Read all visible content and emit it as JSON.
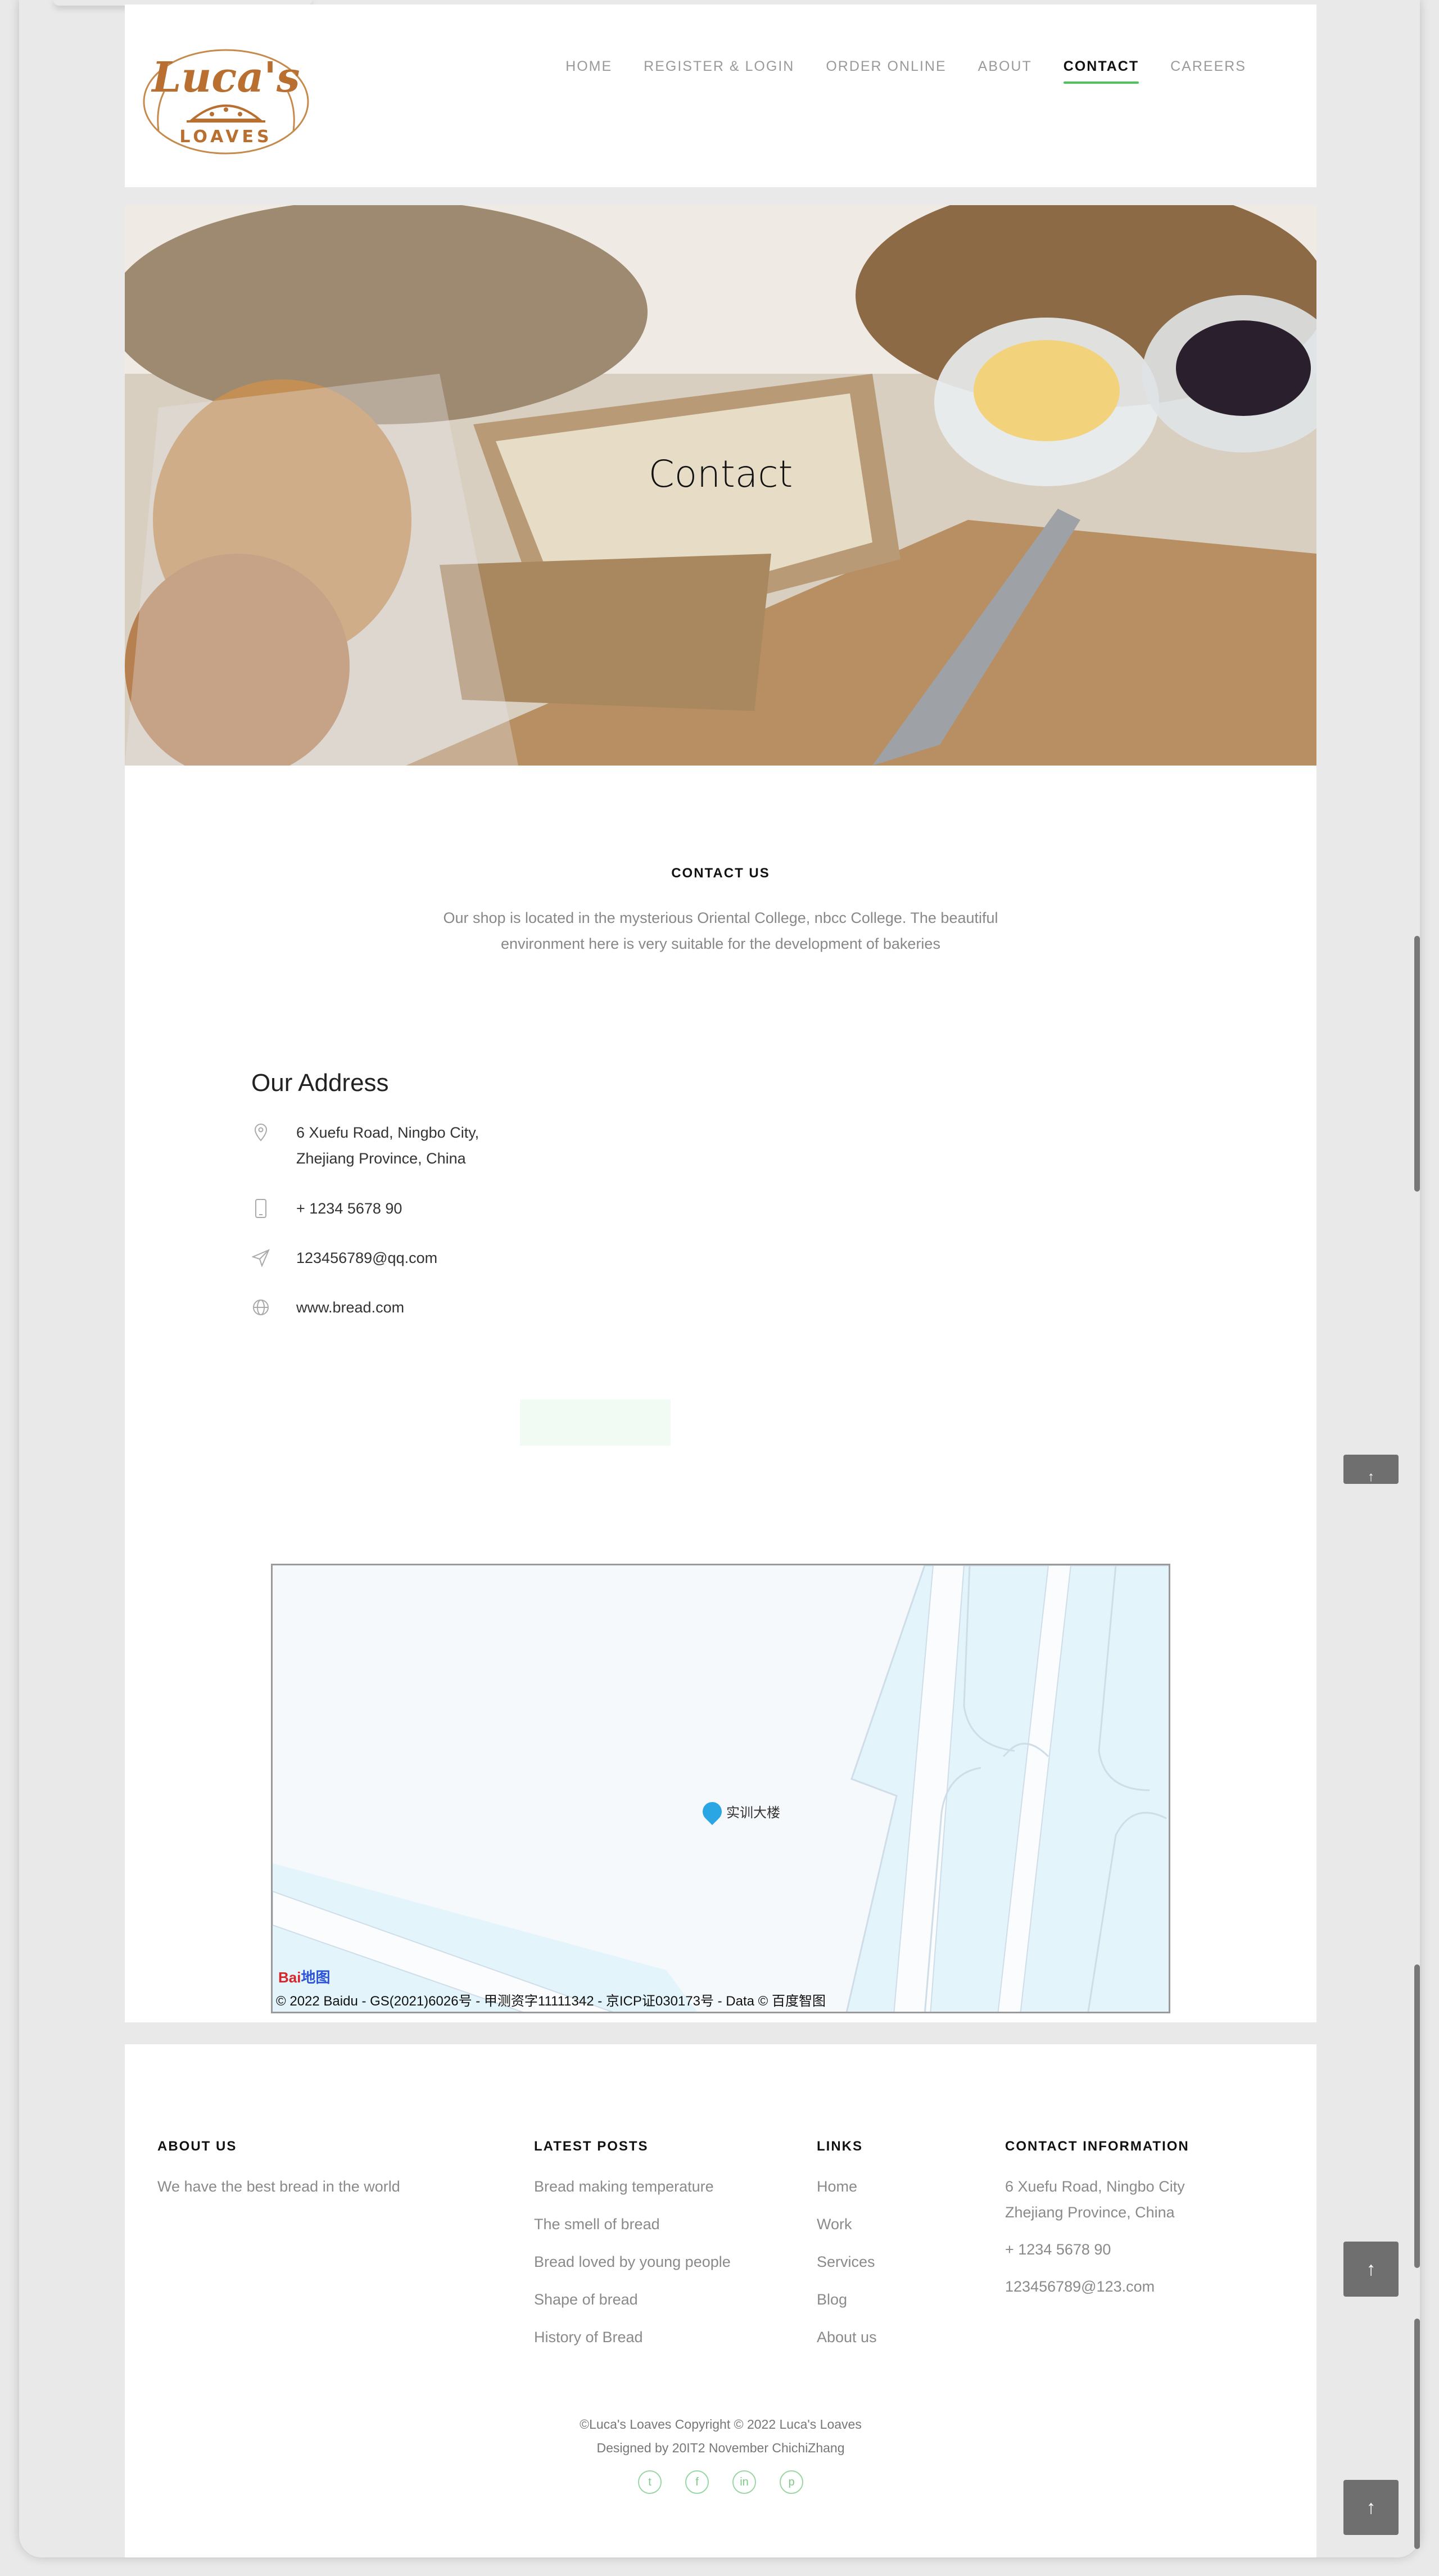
{
  "brand": {
    "logo_top": "Luca's",
    "logo_bottom": "LOAVES"
  },
  "nav": {
    "items": [
      {
        "label": "HOME",
        "active": false
      },
      {
        "label": "REGISTER & LOGIN",
        "active": false
      },
      {
        "label": "ORDER ONLINE",
        "active": false
      },
      {
        "label": "ABOUT",
        "active": false
      },
      {
        "label": "CONTACT",
        "active": true
      },
      {
        "label": "CAREERS",
        "active": false
      }
    ],
    "active_color": "#4cc45a"
  },
  "hero": {
    "title": "Contact"
  },
  "contact": {
    "heading": "CONTACT US",
    "intro": "Our shop is located in the mysterious Oriental College, nbcc College. The beautiful environment here is very suitable for the development of bakeries",
    "address_title": "Our Address",
    "address_line1": "6 Xuefu Road, Ningbo City,",
    "address_line2": "Zhejiang Province, China",
    "phone": "+ 1234 5678 90",
    "email": "123456789@qq.com",
    "website": "www.bread.com",
    "icons": [
      "map-pin-icon",
      "phone-icon",
      "send-icon",
      "globe-icon"
    ]
  },
  "map": {
    "poi_label": "实训大楼",
    "logo_text": "Bai",
    "logo_suffix": "地图",
    "copyright": "© 2022 Baidu - GS(2021)6026号 - 甲测资字11111342 - 京ICP证030173号 - Data © 百度智图"
  },
  "footer": {
    "about": {
      "title": "ABOUT US",
      "text": "We have the best bread in the world"
    },
    "posts": {
      "title": "LATEST POSTS",
      "items": [
        "Bread making temperature",
        "The smell of bread",
        "Bread loved by young people",
        "Shape of bread",
        "History of Bread"
      ]
    },
    "links": {
      "title": "LINKS",
      "items": [
        "Home",
        "Work",
        "Services",
        "Blog",
        "About us"
      ]
    },
    "info": {
      "title": "CONTACT INFORMATION",
      "address_line1": "6 Xuefu Road, Ningbo City",
      "address_line2": "Zhejiang Province, China",
      "phone": "+ 1234 5678 90",
      "email": "123456789@123.com"
    },
    "copyright_line1": "©Luca's Loaves Copyright © 2022 Luca's Loaves",
    "copyright_line2": "Designed by 20IT2 November ChichiZhang",
    "socials": [
      "twitter-icon",
      "facebook-icon",
      "linkedin-icon",
      "pinterest-icon"
    ]
  }
}
